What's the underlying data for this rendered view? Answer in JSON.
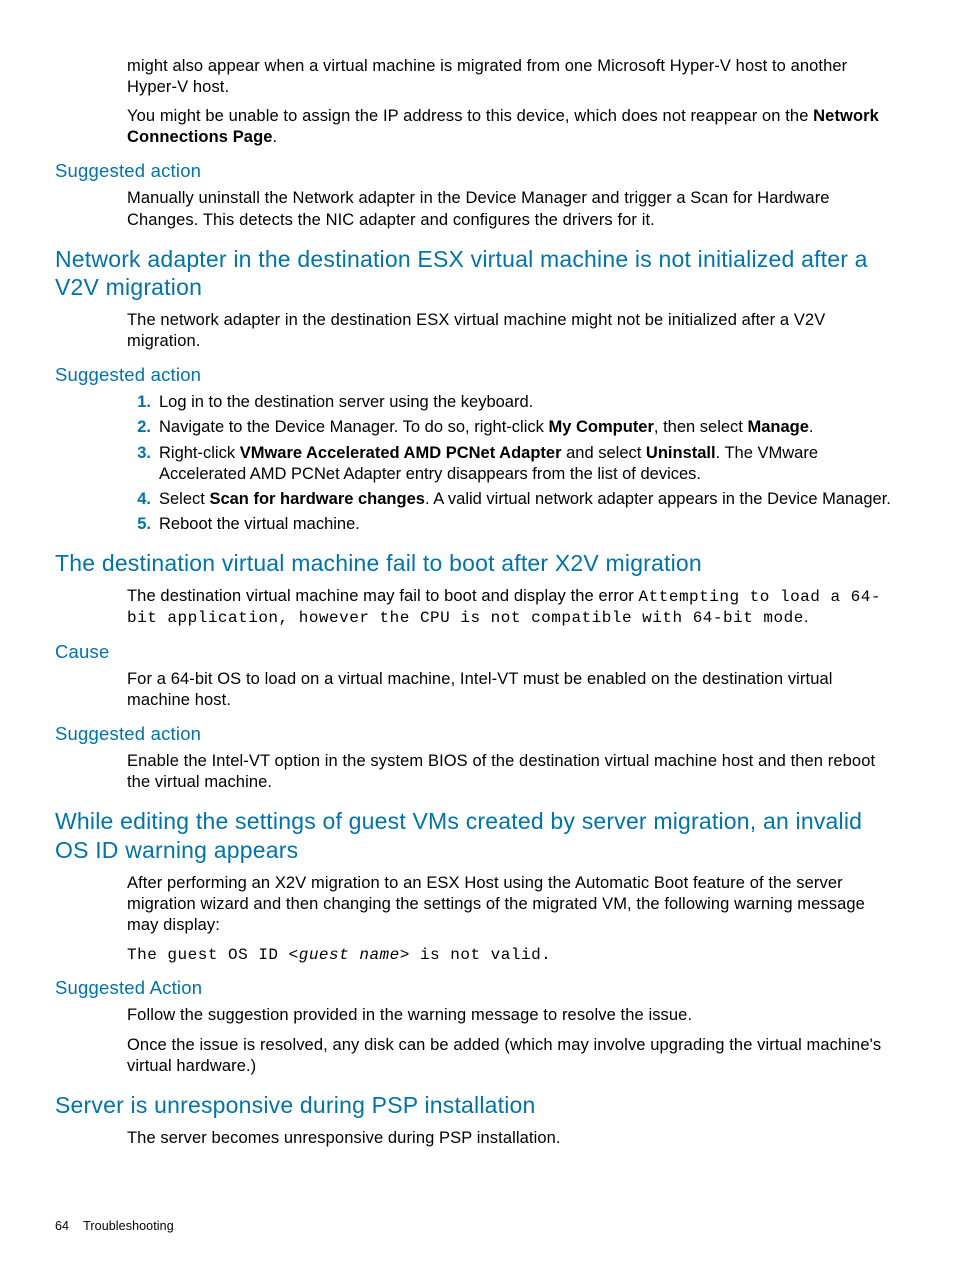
{
  "intro": {
    "p1a": "might also appear when a virtual machine is migrated from one Microsoft Hyper-V host to another Hyper-V host.",
    "p2a": "You might be unable to assign the IP address to this device, which does not reappear on the ",
    "p2b": "Network Connections Page",
    "p2c": "."
  },
  "sa1": {
    "heading": "Suggested action",
    "body": "Manually uninstall the Network adapter in the Device Manager and trigger a Scan for Hardware Changes. This detects the NIC adapter and configures the drivers for it."
  },
  "sec1": {
    "heading": "Network adapter in the destination ESX virtual machine is not initialized after a V2V migration",
    "body": "The network adapter in the destination ESX virtual machine might not be initialized after a V2V migration."
  },
  "sa2": {
    "heading": "Suggested action",
    "steps": [
      {
        "n": "1.",
        "text": "Log in to the destination server using the keyboard."
      },
      {
        "n": "2.",
        "pre": "Navigate to the Device Manager. To do so, right-click ",
        "b1": "My Computer",
        "mid": ", then select ",
        "b2": "Manage",
        "post": "."
      },
      {
        "n": "3.",
        "pre": "Right-click ",
        "b1": "VMware Accelerated AMD PCNet Adapter",
        "mid": " and select ",
        "b2": "Uninstall",
        "post": ". The VMware Accelerated AMD PCNet Adapter entry disappears from the list of devices."
      },
      {
        "n": "4.",
        "pre": "Select ",
        "b1": "Scan for hardware changes",
        "post": ". A valid virtual network adapter appears in the Device Manager."
      },
      {
        "n": "5.",
        "text": "Reboot the virtual machine."
      }
    ]
  },
  "sec2": {
    "heading": "The destination virtual machine fail to boot after X2V migration",
    "body_pre": "The destination virtual machine may fail to boot and display the error ",
    "body_code": "Attempting to load a 64-bit application, however the CPU is not compatible with 64-bit mode",
    "body_post": "."
  },
  "cause": {
    "heading": "Cause",
    "body": "For a 64-bit OS to load on a virtual machine, Intel-VT must be enabled on the destination virtual machine host."
  },
  "sa3": {
    "heading": "Suggested action",
    "body": "Enable the Intel-VT option in the system BIOS of the destination virtual machine host and then reboot the virtual machine."
  },
  "sec3": {
    "heading": "While editing the settings of guest VMs created by server migration, an invalid OS ID warning appears",
    "body": "After performing an X2V migration to an ESX Host using the Automatic Boot feature of the server migration wizard and then changing the settings of the migrated VM, the following warning message may display:",
    "code_pre": "The guest OS ID ",
    "code_var": "<guest name>",
    "code_post": " is not valid."
  },
  "sa4": {
    "heading": "Suggested Action",
    "p1": "Follow the suggestion provided in the warning message to resolve the issue.",
    "p2": "Once the issue is resolved, any disk can be added (which may involve upgrading the virtual machine's virtual hardware.)"
  },
  "sec4": {
    "heading": "Server is unresponsive during PSP installation",
    "body": "The server becomes unresponsive during PSP installation."
  },
  "footer": {
    "page": "64",
    "title": "Troubleshooting"
  }
}
